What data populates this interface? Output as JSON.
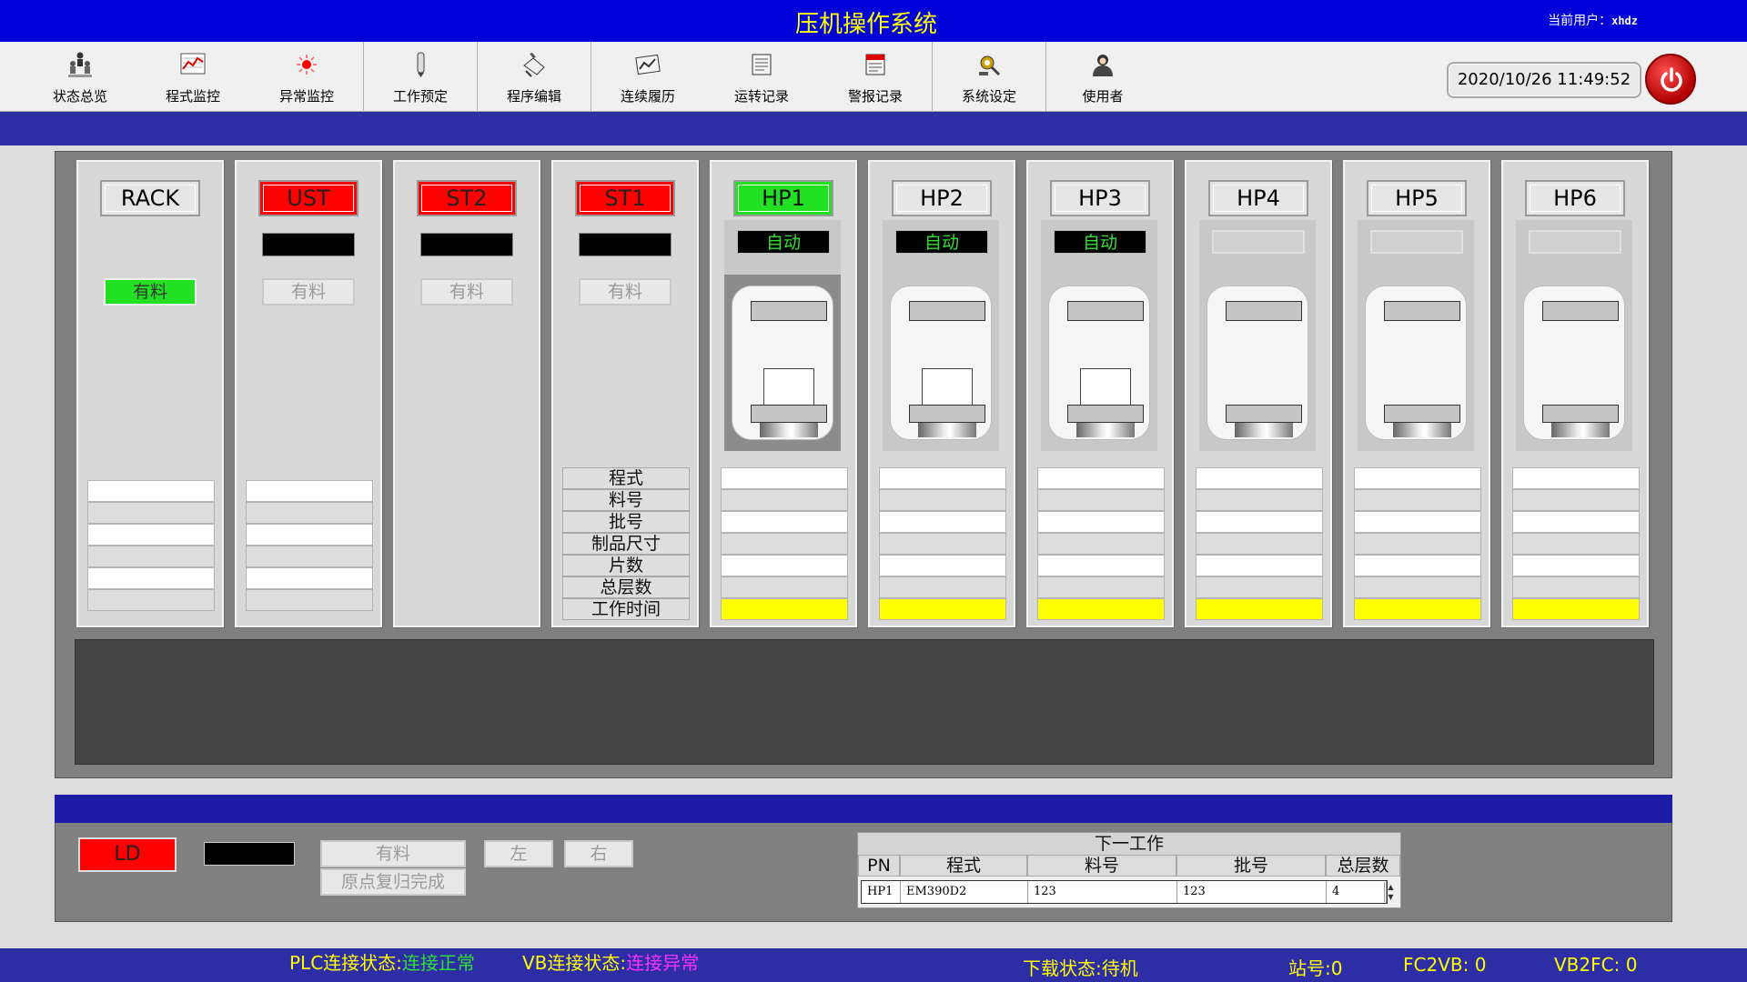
{
  "header": {
    "title": "压机操作系统",
    "user_label": "当前用户：",
    "user_name": "xhdz"
  },
  "toolbar": {
    "items": [
      {
        "label": "状态总览",
        "icon": "people-tree-icon"
      },
      {
        "label": "程式监控",
        "icon": "chart-monitor-icon"
      },
      {
        "label": "异常监控",
        "icon": "red-light-icon"
      },
      {
        "label": "工作预定",
        "icon": "pencil-icon"
      },
      {
        "label": "程序编辑",
        "icon": "hand-edit-icon"
      },
      {
        "label": "连续履历",
        "icon": "chart-history-icon"
      },
      {
        "label": "运转记录",
        "icon": "log-book-icon"
      },
      {
        "label": "警报记录",
        "icon": "alarm-log-icon"
      },
      {
        "label": "系统设定",
        "icon": "gear-tools-icon"
      },
      {
        "label": "使用者",
        "icon": "user-icon"
      }
    ],
    "datetime": "2020/10/26   11:49:52",
    "power_icon": "power-icon"
  },
  "stations": {
    "rack": {
      "name": "RACK",
      "material": "有料",
      "material_on": true
    },
    "ust": {
      "name": "UST",
      "material": "有料"
    },
    "st2": {
      "name": "ST2",
      "material": "有料"
    },
    "st1": {
      "name": "ST1",
      "material": "有料"
    },
    "info_labels": [
      "程式",
      "料号",
      "批号",
      "制品尺寸",
      "片数",
      "总层数",
      "工作时间"
    ]
  },
  "presses": [
    {
      "name": "HP1",
      "mode": "自动",
      "active": true
    },
    {
      "name": "HP2",
      "mode": "自动",
      "active": false
    },
    {
      "name": "HP3",
      "mode": "自动",
      "active": false
    },
    {
      "name": "HP4",
      "mode": "",
      "active": false
    },
    {
      "name": "HP5",
      "mode": "",
      "active": false
    },
    {
      "name": "HP6",
      "mode": "",
      "active": false
    }
  ],
  "loader": {
    "name": "LD",
    "material": "有料",
    "home_done": "原点复归完成",
    "left": "左",
    "right": "右"
  },
  "next_job": {
    "title": "下一工作",
    "columns": [
      "PN",
      "程式",
      "料号",
      "批号",
      "总层数"
    ],
    "row": [
      "HP1",
      "EM390D2",
      "123",
      "123",
      "4"
    ]
  },
  "status": {
    "plc_label": "PLC连接状态:",
    "plc_value": "连接正常",
    "vb_label": "VB连接状态:",
    "vb_value": "连接异常",
    "download_label": "下载状态:",
    "download_value": "待机",
    "station_label": "站号:",
    "station_value": "0",
    "fc2vb_label": "FC2VB:",
    "fc2vb_value": "0",
    "vb2fc_label": "VB2FC:",
    "vb2fc_value": "0"
  },
  "colors": {
    "title_bar": "#0000d8",
    "title_text": "#ffff00",
    "alarm_red": "#ff0000",
    "ok_green": "#22e022",
    "status_ok": "#30e030",
    "status_error": "#ff30ff"
  }
}
